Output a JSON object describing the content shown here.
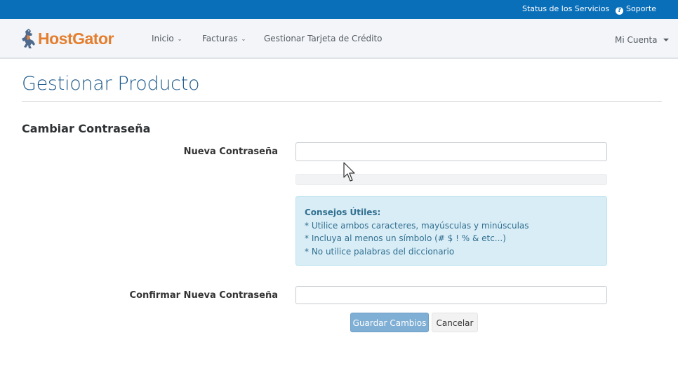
{
  "topbar": {
    "status_label": "Status de los Servicios",
    "support_label": "Soporte",
    "support_icon": "question-circle-icon"
  },
  "brand": {
    "name": "HostGator",
    "color": "#e47e2f"
  },
  "nav": {
    "items": [
      {
        "label": "Inicio",
        "has_dropdown": true
      },
      {
        "label": "Facturas",
        "has_dropdown": true
      },
      {
        "label": "Gestionar Tarjeta de Crédito",
        "has_dropdown": false
      }
    ],
    "account_label": "Mi Cuenta"
  },
  "page": {
    "title": "Gestionar Producto",
    "section_title": "Cambiar Contraseña"
  },
  "form": {
    "new_password_label": "Nueva Contraseña",
    "new_password_value": "",
    "confirm_password_label": "Confirmar Nueva Contraseña",
    "confirm_password_value": "",
    "strength_percent": 0
  },
  "tips": {
    "title": "Consejos Útiles:",
    "items": [
      "* Utilice ambos caracteres, mayúsculas y minúsculas",
      "* Incluya al menos un símbolo (# $ ! % & etc...)",
      "* No utilice palabras del diccionario"
    ]
  },
  "buttons": {
    "save_label": "Guardar Cambios",
    "cancel_label": "Cancelar"
  },
  "colors": {
    "topbar": "#0a6fb9",
    "title": "#1d5a8c",
    "primary_button": "#7fafd4",
    "tips_background": "#d9edf7",
    "tips_text": "#31708f"
  }
}
